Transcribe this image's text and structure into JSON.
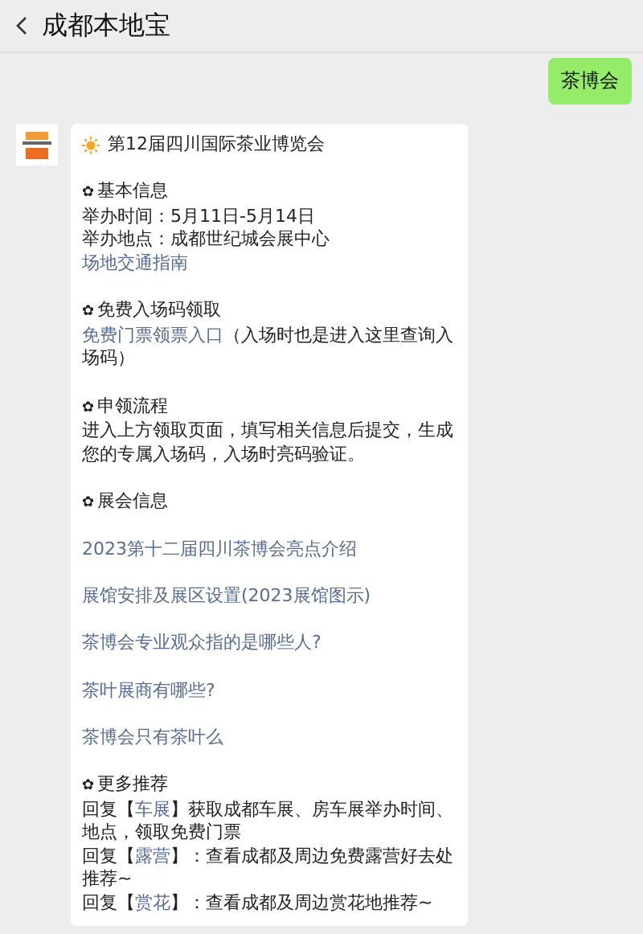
{
  "header": {
    "title": "成都本地宝"
  },
  "messages": [
    {
      "kind": "outgoing",
      "text": "茶博会"
    },
    {
      "kind": "incoming",
      "title": "第12届四川国际茶业博览会",
      "sections": [
        {
          "bullet": "✿",
          "heading": "基本信息",
          "lines": [
            {
              "kind": "text",
              "segments": [
                {
                  "kind": "plain",
                  "text": "举办时间：5月11日-5月14日"
                }
              ]
            },
            {
              "kind": "text",
              "segments": [
                {
                  "kind": "plain",
                  "text": "举办地点：成都世纪城会展中心"
                }
              ]
            },
            {
              "kind": "link",
              "text": "场地交通指南"
            }
          ]
        },
        {
          "bullet": "✿",
          "heading": "免费入场码领取",
          "lines": [
            {
              "kind": "text",
              "segments": [
                {
                  "kind": "link",
                  "text": "免费门票领票入口"
                },
                {
                  "kind": "plain",
                  "text": "（入场时也是进入这里查询入场码）"
                }
              ]
            }
          ]
        },
        {
          "bullet": "✿",
          "heading": "申领流程",
          "lines": [
            {
              "kind": "text",
              "segments": [
                {
                  "kind": "plain",
                  "text": "进入上方领取页面，填写相关信息后提交，生成您的专属入场码，入场时亮码验证。"
                }
              ]
            }
          ]
        },
        {
          "bullet": "✿",
          "heading": "展会信息",
          "lines": [
            {
              "kind": "spaced-link",
              "text": "2023第十二届四川茶博会亮点介绍"
            },
            {
              "kind": "spaced-link",
              "text": "展馆安排及展区设置(2023展馆图示)"
            },
            {
              "kind": "spaced-link",
              "text": "茶博会专业观众指的是哪些人?"
            },
            {
              "kind": "spaced-link",
              "text": "茶叶展商有哪些?"
            },
            {
              "kind": "spaced-link",
              "text": "茶博会只有茶叶么"
            }
          ]
        },
        {
          "bullet": "✿",
          "heading": "更多推荐",
          "lines": [
            {
              "kind": "text",
              "segments": [
                {
                  "kind": "plain",
                  "text": "回复【"
                },
                {
                  "kind": "link",
                  "text": "车展"
                },
                {
                  "kind": "plain",
                  "text": "】获取成都车展、房车展举办时间、地点，领取免费门票"
                }
              ]
            },
            {
              "kind": "text",
              "segments": [
                {
                  "kind": "plain",
                  "text": "回复【"
                },
                {
                  "kind": "link",
                  "text": "露营"
                },
                {
                  "kind": "plain",
                  "text": "】：查看成都及周边免费露营好去处推荐~"
                }
              ]
            },
            {
              "kind": "text",
              "segments": [
                {
                  "kind": "plain",
                  "text": "回复【"
                },
                {
                  "kind": "link",
                  "text": "赏花"
                },
                {
                  "kind": "plain",
                  "text": "】：查看成都及周边赏花地推荐~"
                }
              ]
            }
          ]
        }
      ]
    }
  ]
}
